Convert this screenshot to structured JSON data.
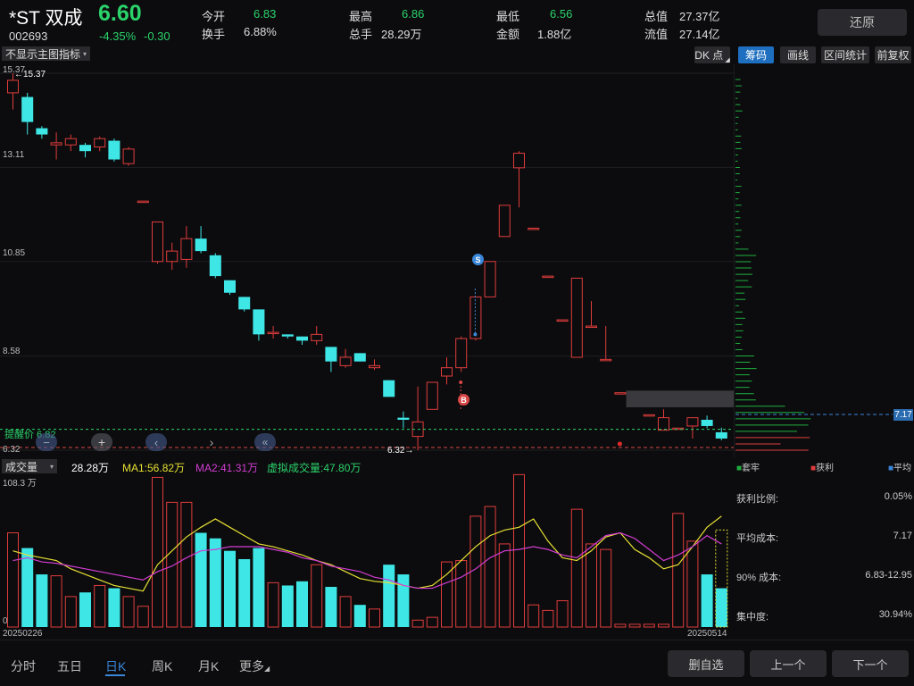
{
  "header": {
    "name": "*ST 双成",
    "price": "6.60",
    "code": "002693",
    "change_pct": "-4.35%",
    "change_amt": "-0.30",
    "stats": [
      {
        "label": "今开",
        "value": "6.83",
        "color": "#2bd36b"
      },
      {
        "label": "换手",
        "value": "6.88%",
        "color": "#dddddd"
      },
      {
        "label": "最高",
        "value": "6.86",
        "color": "#2bd36b"
      },
      {
        "label": "总手",
        "value": "28.29万",
        "color": "#dddddd"
      },
      {
        "label": "最低",
        "value": "6.56",
        "color": "#2bd36b"
      },
      {
        "label": "金额",
        "value": "1.88亿",
        "color": "#dddddd"
      },
      {
        "label": "总值",
        "value": "27.37亿",
        "color": "#dddddd"
      },
      {
        "label": "流值",
        "value": "27.14亿",
        "color": "#dddddd"
      }
    ],
    "restore_label": "还原"
  },
  "toolbar": {
    "indicator_select": "不显示主图指标",
    "dk_label": "DK 点",
    "chips_label": "筹码",
    "draw_label": "画线",
    "range_label": "区间统计",
    "adjust_label": "前复权"
  },
  "main_chart": {
    "ylabels": [
      "15.37",
      "13.11",
      "10.85",
      "8.58",
      "6.32"
    ],
    "high_marker": "←15.37",
    "low_marker": "6.32→",
    "alert_label": "提醒价 6.82",
    "signal_s": "S",
    "signal_b": "B",
    "chips_price": "7.17"
  },
  "volume": {
    "select_label": "成交量",
    "value": "28.28万",
    "ma1": "MA1:56.82万",
    "ma2": "MA2:41.31万",
    "virtual": "虚拟成交量:47.80万",
    "max_label": "108.3 万",
    "zero_label": "0",
    "start_date": "20250226",
    "end_date": "20250514"
  },
  "chips_panel": {
    "legend": [
      {
        "label": "套牢",
        "color": "#1fae3e"
      },
      {
        "label": "获利",
        "color": "#e03c3c"
      },
      {
        "label": "平均",
        "color": "#3a86d8"
      }
    ],
    "stats": [
      {
        "label": "获利比例:",
        "value": "0.05%"
      },
      {
        "label": "平均成本:",
        "value": "7.17"
      },
      {
        "label": "90% 成本:",
        "value": "6.83-12.95"
      },
      {
        "label": "集中度:",
        "value": "30.94%"
      }
    ]
  },
  "bottom": {
    "tabs": [
      "分时",
      "五日",
      "日K",
      "周K",
      "月K",
      "更多"
    ],
    "active_tab": "日K",
    "btn_remove": "删自选",
    "btn_prev": "上一个",
    "btn_next": "下一个"
  },
  "chart_data": {
    "type": "candlestick",
    "ylim": [
      6.32,
      15.37
    ],
    "colors": {
      "up": "#e03c3c",
      "down": "#3fe6e6",
      "ma1": "#e6e033",
      "ma2": "#d13dd1"
    },
    "candles": [
      {
        "o": 14.9,
        "c": 15.2,
        "h": 15.37,
        "l": 14.5
      },
      {
        "o": 14.8,
        "c": 14.2,
        "h": 14.9,
        "l": 13.9
      },
      {
        "o": 14.05,
        "c": 13.9,
        "h": 14.1,
        "l": 13.8
      },
      {
        "o": 13.65,
        "c": 13.7,
        "h": 13.95,
        "l": 13.3
      },
      {
        "o": 13.65,
        "c": 13.8,
        "h": 13.9,
        "l": 13.5
      },
      {
        "o": 13.65,
        "c": 13.5,
        "h": 13.7,
        "l": 13.35
      },
      {
        "o": 13.6,
        "c": 13.8,
        "h": 13.85,
        "l": 13.5
      },
      {
        "o": 13.75,
        "c": 13.3,
        "h": 13.8,
        "l": 13.25
      },
      {
        "o": 13.2,
        "c": 13.55,
        "h": 13.6,
        "l": 13.15
      },
      {
        "o": 12.3,
        "c": 12.3,
        "h": 12.3,
        "l": 12.3
      },
      {
        "o": 10.85,
        "c": 11.8,
        "h": 11.8,
        "l": 10.8
      },
      {
        "o": 10.85,
        "c": 11.1,
        "h": 11.3,
        "l": 10.65
      },
      {
        "o": 10.9,
        "c": 11.4,
        "h": 11.7,
        "l": 10.7
      },
      {
        "o": 11.4,
        "c": 11.1,
        "h": 11.7,
        "l": 11.05
      },
      {
        "o": 11.0,
        "c": 10.5,
        "h": 11.05,
        "l": 10.45
      },
      {
        "o": 10.4,
        "c": 10.1,
        "h": 10.4,
        "l": 10.05
      },
      {
        "o": 10.0,
        "c": 9.7,
        "h": 10.0,
        "l": 9.65
      },
      {
        "o": 9.7,
        "c": 9.1,
        "h": 9.7,
        "l": 8.95
      },
      {
        "o": 9.15,
        "c": 9.15,
        "h": 9.3,
        "l": 9.0
      },
      {
        "o": 9.1,
        "c": 9.05,
        "h": 9.1,
        "l": 9.0
      },
      {
        "o": 9.05,
        "c": 8.95,
        "h": 9.05,
        "l": 8.85
      },
      {
        "o": 8.95,
        "c": 9.1,
        "h": 9.3,
        "l": 8.85
      },
      {
        "o": 8.8,
        "c": 8.45,
        "h": 8.8,
        "l": 8.2
      },
      {
        "o": 8.35,
        "c": 8.55,
        "h": 8.75,
        "l": 8.3
      },
      {
        "o": 8.65,
        "c": 8.45,
        "h": 8.65,
        "l": 8.45
      },
      {
        "o": 8.3,
        "c": 8.35,
        "h": 8.5,
        "l": 8.25
      },
      {
        "o": 8.0,
        "c": 7.6,
        "h": 8.0,
        "l": 7.6
      },
      {
        "o": 7.1,
        "c": 7.05,
        "h": 7.25,
        "l": 6.85
      },
      {
        "o": 6.65,
        "c": 7.0,
        "h": 7.85,
        "l": 6.32
      },
      {
        "o": 7.3,
        "c": 7.95,
        "h": 7.95,
        "l": 7.3
      },
      {
        "o": 8.1,
        "c": 8.3,
        "h": 8.55,
        "l": 7.9
      },
      {
        "o": 8.3,
        "c": 9.0,
        "h": 9.05,
        "l": 8.2
      },
      {
        "o": 9.0,
        "c": 10.0,
        "h": 10.0,
        "l": 8.95
      },
      {
        "o": 10.0,
        "c": 10.85,
        "h": 10.85,
        "l": 10.0
      },
      {
        "o": 11.45,
        "c": 12.2,
        "h": 12.2,
        "l": 11.45
      },
      {
        "o": 13.1,
        "c": 13.45,
        "h": 13.5,
        "l": 12.15
      },
      {
        "o": 11.65,
        "c": 11.65,
        "h": 11.65,
        "l": 11.65
      },
      {
        "o": 10.5,
        "c": 10.5,
        "h": 10.5,
        "l": 10.5
      },
      {
        "o": 9.45,
        "c": 9.45,
        "h": 9.45,
        "l": 9.45
      },
      {
        "o": 8.55,
        "c": 10.45,
        "h": 10.45,
        "l": 8.55
      },
      {
        "o": 9.3,
        "c": 9.3,
        "h": 9.9,
        "l": 9.3
      },
      {
        "o": 8.5,
        "c": 8.5,
        "h": 9.3,
        "l": 8.5
      },
      {
        "o": 7.7,
        "c": 7.7,
        "h": 7.7,
        "l": 7.7
      },
      {
        "o": 7.55,
        "c": 7.55,
        "h": 7.55,
        "l": 7.55
      },
      {
        "o": 7.17,
        "c": 7.17,
        "h": 7.17,
        "l": 7.17
      },
      {
        "o": 6.8,
        "c": 7.1,
        "h": 7.3,
        "l": 6.8
      },
      {
        "o": 6.85,
        "c": 6.85,
        "h": 6.85,
        "l": 6.85
      },
      {
        "o": 6.9,
        "c": 7.1,
        "h": 7.1,
        "l": 6.6
      },
      {
        "o": 7.05,
        "c": 6.9,
        "h": 7.15,
        "l": 6.85
      },
      {
        "o": 6.75,
        "c": 6.6,
        "h": 6.86,
        "l": 6.56
      }
    ],
    "volumes": [
      0.68,
      0.57,
      0.38,
      0.37,
      0.22,
      0.25,
      0.3,
      0.28,
      0.22,
      0.15,
      1.08,
      0.9,
      0.9,
      0.68,
      0.64,
      0.55,
      0.49,
      0.57,
      0.32,
      0.3,
      0.33,
      0.45,
      0.29,
      0.22,
      0.16,
      0.13,
      0.45,
      0.38,
      0.05,
      0.07,
      0.47,
      0.48,
      0.8,
      0.87,
      0.6,
      1.1,
      0.16,
      0.12,
      0.19,
      0.85,
      0.6,
      0.56,
      0.02,
      0.02,
      0.02,
      0.02,
      0.82,
      0.62,
      0.38,
      0.28
    ],
    "volume_ylim": [
      0,
      1.083
    ],
    "ma1": [
      0.55,
      0.52,
      0.5,
      0.48,
      0.42,
      0.38,
      0.34,
      0.3,
      0.28,
      0.26,
      0.45,
      0.55,
      0.65,
      0.72,
      0.78,
      0.72,
      0.66,
      0.6,
      0.58,
      0.55,
      0.52,
      0.48,
      0.45,
      0.4,
      0.35,
      0.33,
      0.32,
      0.3,
      0.28,
      0.3,
      0.38,
      0.48,
      0.58,
      0.66,
      0.7,
      0.72,
      0.78,
      0.62,
      0.5,
      0.48,
      0.55,
      0.65,
      0.68,
      0.56,
      0.5,
      0.42,
      0.45,
      0.58,
      0.72,
      0.8
    ],
    "ma2": [
      0.48,
      0.5,
      0.47,
      0.46,
      0.44,
      0.42,
      0.4,
      0.38,
      0.36,
      0.34,
      0.4,
      0.44,
      0.5,
      0.55,
      0.56,
      0.58,
      0.58,
      0.58,
      0.56,
      0.54,
      0.5,
      0.48,
      0.44,
      0.42,
      0.4,
      0.36,
      0.34,
      0.3,
      0.28,
      0.28,
      0.32,
      0.36,
      0.42,
      0.5,
      0.55,
      0.56,
      0.58,
      0.56,
      0.52,
      0.5,
      0.58,
      0.66,
      0.68,
      0.64,
      0.56,
      0.48,
      0.52,
      0.58,
      0.66,
      0.6
    ]
  }
}
